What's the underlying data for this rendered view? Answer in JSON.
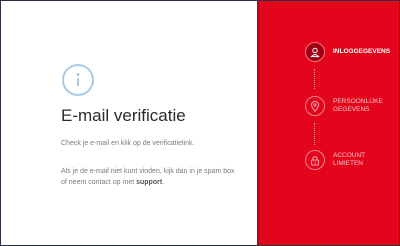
{
  "main": {
    "title": "E-mail verificatie",
    "instruction": "Check je e-mail en klik op de verificatielink.",
    "help_text": "Als je de e-mail niet kunt vinden, kijk dan in je spam box of neem contact op met ",
    "support_link": "support",
    "help_text_end": "."
  },
  "steps": [
    {
      "icon": "user-icon",
      "line1": "INLOGGEGEVENS",
      "line2": "",
      "state": "active"
    },
    {
      "icon": "location-pin-icon",
      "line1": "PERSOONLIJKE",
      "line2": "GEGEVENS",
      "state": "inactive"
    },
    {
      "icon": "lock-icon",
      "line1": "ACCOUNT",
      "line2": "LIMIETEN",
      "state": "inactive"
    }
  ],
  "colors": {
    "accent_red": "#e3051b",
    "active_step": "#9c0012",
    "info_icon": "#a9cbe6",
    "title_text": "#2b2b2b",
    "body_text": "#7a7a7a"
  }
}
